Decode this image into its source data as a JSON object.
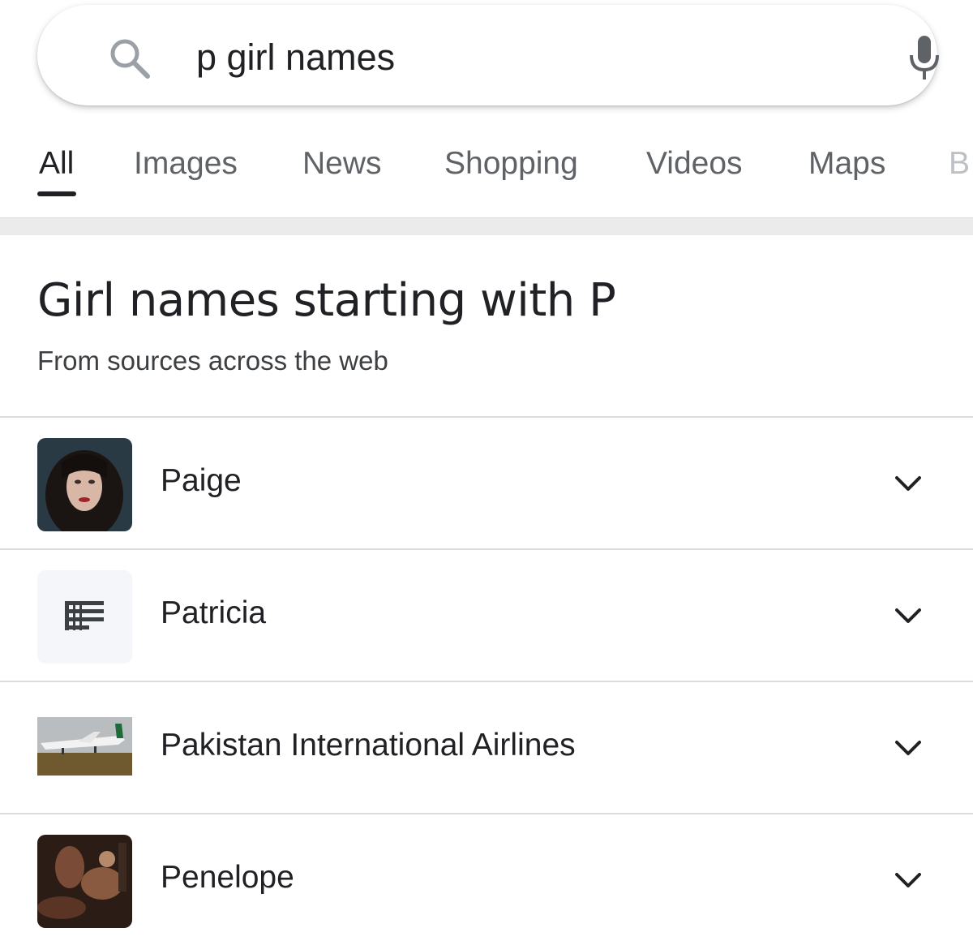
{
  "search": {
    "query": "p girl names",
    "search_icon": "search-icon",
    "mic_icon": "mic-icon"
  },
  "tabs": [
    {
      "label": "All",
      "active": true
    },
    {
      "label": "Images"
    },
    {
      "label": "News"
    },
    {
      "label": "Shopping"
    },
    {
      "label": "Videos"
    },
    {
      "label": "Maps"
    },
    {
      "label": "B"
    }
  ],
  "section": {
    "title": "Girl names starting with P",
    "subtitle": "From sources across the web"
  },
  "results": [
    {
      "label": "Paige",
      "thumbnail": "portrait-photo"
    },
    {
      "label": "Patricia",
      "thumbnail": "text-lines-icon"
    },
    {
      "label": "Pakistan International Airlines",
      "thumbnail": "airplane-photo"
    },
    {
      "label": "Penelope",
      "thumbnail": "painting-photo"
    }
  ],
  "colors": {
    "text": "#202124",
    "muted": "#5f6368",
    "divider": "#dadce0"
  }
}
